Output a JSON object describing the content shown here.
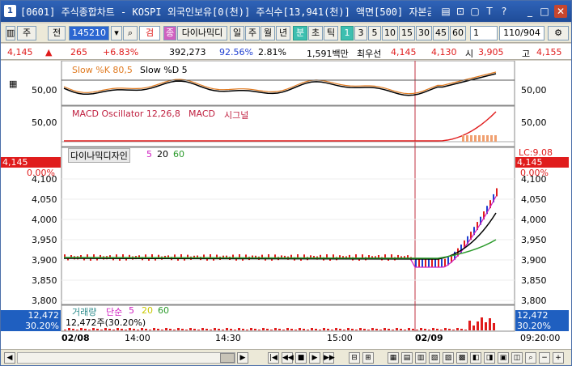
{
  "window": {
    "number": "1",
    "title": "[0601] 주식종합차트 - KOSPI 외국인보유[0(천)] 주식수[13,941(천)] 액면[500] 자본금[70(억",
    "buttons": [
      "▤",
      "⊡",
      "▢",
      "T",
      "?",
      "_",
      "□",
      "✕"
    ]
  },
  "toolbar": {
    "menu": "주",
    "type": "전",
    "code": "145210",
    "search_icon": "search-icon",
    "filter": "검",
    "tag": "종",
    "name": "다이나믹디",
    "periods": [
      "일",
      "주",
      "월",
      "년"
    ],
    "minute": "분",
    "second": "초",
    "tick": "틱",
    "intervals": [
      "1",
      "3",
      "5",
      "10",
      "15",
      "30",
      "45",
      "60"
    ],
    "selected_interval": "1",
    "count_select": "1",
    "page_count": "110/904"
  },
  "quote": {
    "price": "4,145",
    "change": "265",
    "change_pct": "+6.83%",
    "volume": "392,273",
    "ratio": "92.56%",
    "turnover": "2.81%",
    "amount": "1,591백만",
    "best_label": "최우선",
    "best_ask": "4,145",
    "best_bid": "4,130",
    "open_label": "시",
    "open": "3,905",
    "high_label": "고",
    "high": "4,155"
  },
  "panels": {
    "slow": {
      "label_k": "Slow %K 80,5",
      "label_d": "Slow %D 5",
      "axis": [
        "50,00"
      ]
    },
    "macd": {
      "label": "MACD Oscillator 12,26,8",
      "label2": "MACD",
      "label3": "시그널",
      "axis": [
        "50,00"
      ]
    },
    "price": {
      "name": "다이나믹디자인",
      "ma": [
        "5",
        "20",
        "60"
      ],
      "current": "4,145",
      "current_pct": "0.00%",
      "lc_label": "LC:9.08",
      "ticks": [
        "4,100",
        "4,050",
        "4,000",
        "3,950",
        "3,900",
        "3,850",
        "3,800"
      ]
    },
    "volume": {
      "label": "거래량",
      "sub": "단순",
      "ma": [
        "5",
        "20",
        "60"
      ],
      "value": "12,472주(30.20%)",
      "box_value": "12,472",
      "box_pct": "30.20%"
    }
  },
  "xaxis": [
    "02/08",
    "14:00",
    "14:30",
    "15:00",
    "02/09",
    "09:20:00"
  ],
  "colors": {
    "up": "#e01c1c",
    "down": "#1f3fd0",
    "ma5": "#d020c0",
    "ma20": "#000000",
    "ma60": "#2a9a2a",
    "slowk": "#e07a20"
  }
}
